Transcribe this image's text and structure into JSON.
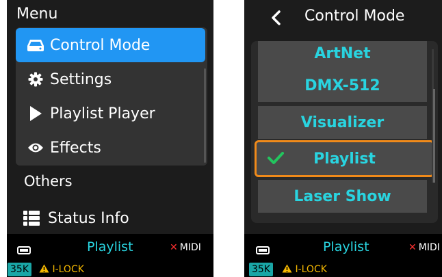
{
  "left": {
    "menu_title": "Menu",
    "items": [
      {
        "label": "Control Mode",
        "icon": "hdd-icon",
        "active": true
      },
      {
        "label": "Settings",
        "icon": "gear-icon",
        "active": false
      },
      {
        "label": "Playlist Player",
        "icon": "play-icon",
        "active": false
      },
      {
        "label": "Effects",
        "icon": "eye-icon",
        "active": false
      }
    ],
    "section_label": "Others",
    "status_info": {
      "label": "Status Info",
      "icon": "list-icon"
    }
  },
  "right": {
    "title": "Control Mode",
    "options": [
      "ArtNet",
      "DMX-512",
      "Visualizer",
      "Playlist",
      "Laser Show"
    ],
    "selected": "Playlist"
  },
  "status_bar": {
    "mode": "Playlist",
    "midi": "MIDI",
    "badge": "35K",
    "ilock": "I-LOCK"
  },
  "colors": {
    "accent_blue": "#2196f3",
    "cyan_text": "#29d4e0",
    "selection_orange": "#f08a1a",
    "check_green": "#22c55e",
    "warning_yellow": "#f5b800",
    "error_red": "#ff3030"
  }
}
